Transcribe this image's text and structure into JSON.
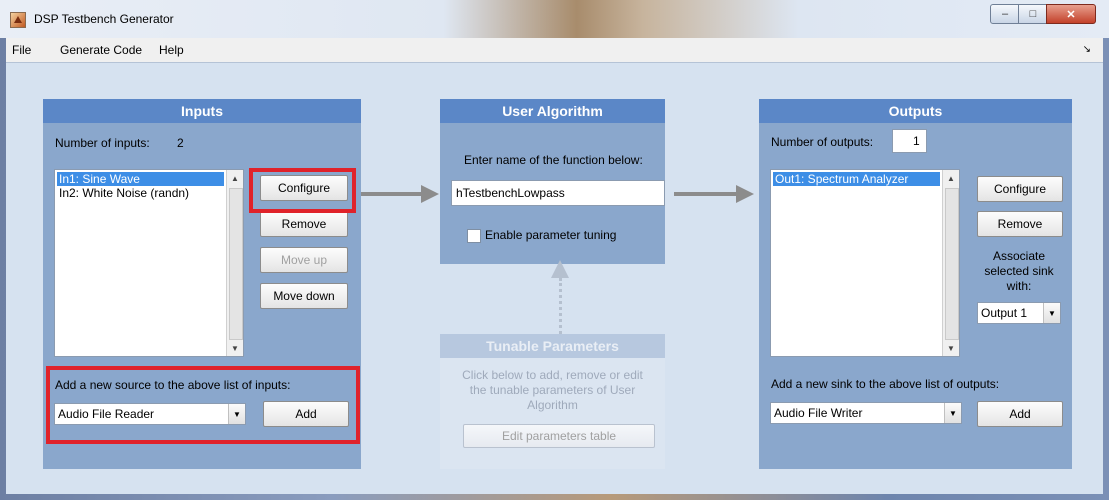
{
  "window": {
    "title": "DSP Testbench Generator"
  },
  "menu": [
    "File",
    "Generate Code",
    "Help"
  ],
  "inputs": {
    "header": "Inputs",
    "count_label": "Number of inputs:",
    "count_value": "2",
    "list": [
      "In1: Sine Wave",
      "In2: White Noise (randn)"
    ],
    "buttons": {
      "configure": "Configure",
      "remove": "Remove",
      "move_up": "Move up",
      "move_down": "Move down"
    },
    "add_label": "Add a new source to the above list of inputs:",
    "source_select": "Audio File Reader",
    "add_button": "Add"
  },
  "algorithm": {
    "header": "User Algorithm",
    "prompt": "Enter name of the function below:",
    "function_name": "hTestbenchLowpass",
    "tuning_checkbox": "Enable parameter tuning"
  },
  "tunable": {
    "header": "Tunable Parameters",
    "description": [
      "Click below to add, remove or edit",
      "the tunable parameters of User",
      "Algorithm"
    ],
    "edit_button": "Edit parameters table"
  },
  "outputs": {
    "header": "Outputs",
    "count_label": "Number of outputs:",
    "count_value": "1",
    "list": [
      "Out1: Spectrum Analyzer"
    ],
    "buttons": {
      "configure": "Configure",
      "remove": "Remove"
    },
    "associate_label": [
      "Associate",
      "selected sink",
      "with:"
    ],
    "output_select": "Output 1",
    "add_label": "Add a new sink to the above list of outputs:",
    "sink_select": "Audio File Writer",
    "add_button": "Add"
  },
  "colors": {
    "panel_header": "#5b87c7",
    "panel_body": "#8aa7cc",
    "selection": "#3d8ee6",
    "highlight": "#e0222a"
  }
}
